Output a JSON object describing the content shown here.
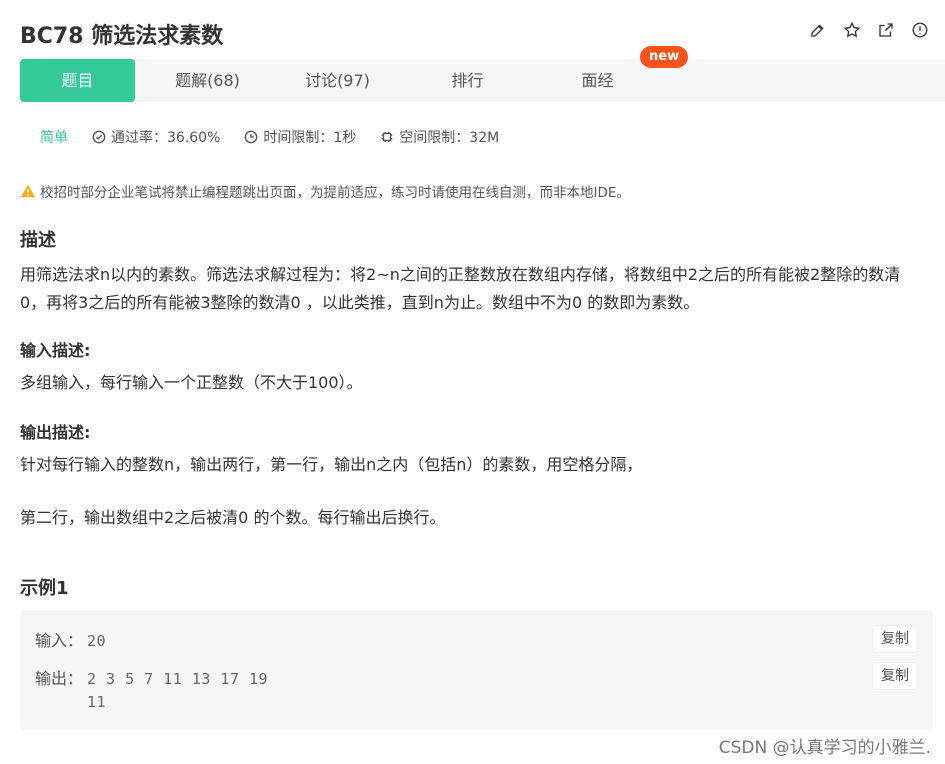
{
  "header": {
    "title": "BC78  筛选法求素数",
    "icons": [
      "edit-icon",
      "star-icon",
      "share-icon",
      "report-icon"
    ]
  },
  "tabs": [
    {
      "label": "题目",
      "active": true
    },
    {
      "label": "题解(68)",
      "active": false
    },
    {
      "label": "讨论(97)",
      "active": false
    },
    {
      "label": "排行",
      "active": false
    },
    {
      "label": "面经",
      "active": false
    }
  ],
  "badge": "new",
  "meta": {
    "level": "简单",
    "pass_rate": "通过率：36.60%",
    "time_limit": "时间限制：1秒",
    "space_limit": "空间限制：32M"
  },
  "notice": "校招时部分企业笔试将禁止编程题跳出页面，为提前适应，练习时请使用在线自测，而非本地IDE。",
  "description": {
    "heading": "描述",
    "text": "用筛选法求n以内的素数。筛选法求解过程为：将2~n之间的正整数放在数组内存储，将数组中2之后的所有能被2整除的数清0，再将3之后的所有能被3整除的数清0 ，以此类推，直到n为止。数组中不为0 的数即为素数。"
  },
  "input_desc": {
    "heading": "输入描述:",
    "text": "多组输入，每行输入一个正整数（不大于100）。"
  },
  "output_desc": {
    "heading": "输出描述:",
    "line1": "针对每行输入的整数n，输出两行，第一行，输出n之内（包括n）的素数，用空格分隔，",
    "line2": "第二行，输出数组中2之后被清0 的个数。每行输出后换行。"
  },
  "example": {
    "heading": "示例1",
    "input_label": "输入：",
    "input_value": "20",
    "output_label": "输出：",
    "output_line1": "2 3 5 7 11 13 17 19",
    "output_line2": "11",
    "copy_label": "复制"
  },
  "watermark": "CSDN @认真学习的小雅兰.",
  "colors": {
    "accent": "#32ca99",
    "badge": "#fa541c",
    "warning": "#faad14"
  }
}
